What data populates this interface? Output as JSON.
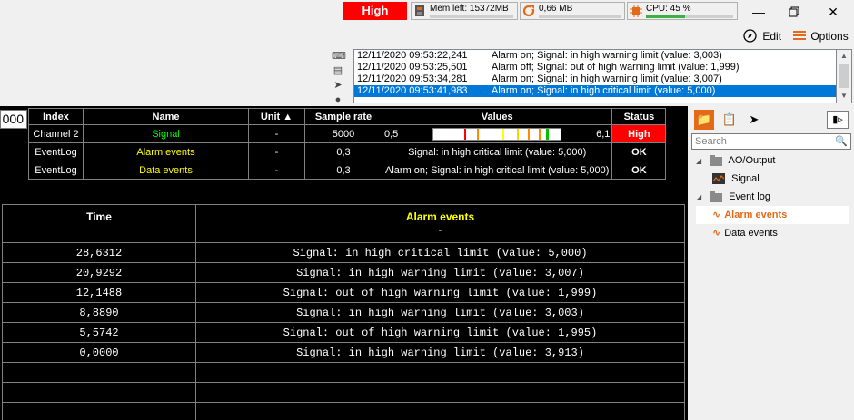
{
  "status_bar": {
    "level": "High",
    "mem_label": "Mem left: 15372MB",
    "net_label": "0,66 MB",
    "cpu_label": "CPU: 45 %",
    "cpu_fraction": 0.45
  },
  "toolbar": {
    "edit_label": "Edit",
    "options_label": "Options"
  },
  "event_log": {
    "rows": [
      {
        "time": "12/11/2020 09:53:22,241",
        "message": "Alarm on; Signal: in high warning limit (value: 3,003)"
      },
      {
        "time": "12/11/2020 09:53:25,501",
        "message": "Alarm off; Signal: out of high warning limit (value: 1,999)"
      },
      {
        "time": "12/11/2020 09:53:34,281",
        "message": "Alarm on; Signal: in high warning limit (value: 3,007)"
      },
      {
        "time": "12/11/2020 09:53:41,983",
        "message": "Alarm on; Signal: in high critical limit (value: 5,000)"
      }
    ]
  },
  "left_input_value": "000",
  "channels": {
    "headers": {
      "index": "Index",
      "name": "Name",
      "unit": "Unit ▲",
      "rate": "Sample rate",
      "values": "Values",
      "status": "Status"
    },
    "rows": [
      {
        "index": "Channel 2",
        "name": "Signal",
        "unit": "-",
        "rate": "5000",
        "min": "0,5",
        "max": "6,1",
        "status": "High"
      },
      {
        "index": "EventLog",
        "name": "Alarm events",
        "unit": "-",
        "rate": "0,3",
        "value": "Signal: in high critical limit (value: 5,000)",
        "status": "OK"
      },
      {
        "index": "EventLog",
        "name": "Data events",
        "unit": "-",
        "rate": "0,3",
        "value": "Alarm on; Signal: in high critical limit (value: 5,000)",
        "status": "OK"
      }
    ]
  },
  "events_table": {
    "time_header": "Time",
    "events_header": "Alarm events",
    "events_subheader": "-",
    "rows": [
      {
        "time": "28,6312",
        "message": "Signal: in high critical limit (value: 5,000)"
      },
      {
        "time": "20,9292",
        "message": "Signal: in high warning limit (value: 3,007)"
      },
      {
        "time": "12,1488",
        "message": "Signal: out of high warning limit (value: 1,999)"
      },
      {
        "time": "8,8890",
        "message": "Signal: in high warning limit (value: 3,003)"
      },
      {
        "time": "5,5742",
        "message": "Signal: out of high warning limit (value: 1,995)"
      },
      {
        "time": "0,0000",
        "message": "Signal: in high warning limit (value: 3,913)"
      },
      {
        "time": "",
        "message": ""
      },
      {
        "time": "",
        "message": ""
      },
      {
        "time": "",
        "message": ""
      }
    ]
  },
  "right_panel": {
    "search_placeholder": "Search",
    "tree": {
      "ao_output": "AO/Output",
      "signal": "Signal",
      "event_log": "Event log",
      "alarm_events": "Alarm events",
      "data_events": "Data events"
    }
  },
  "colors": {
    "accent": "#e26b1a",
    "alarm_red": "#ff0000",
    "selection_blue": "#0078d7"
  }
}
